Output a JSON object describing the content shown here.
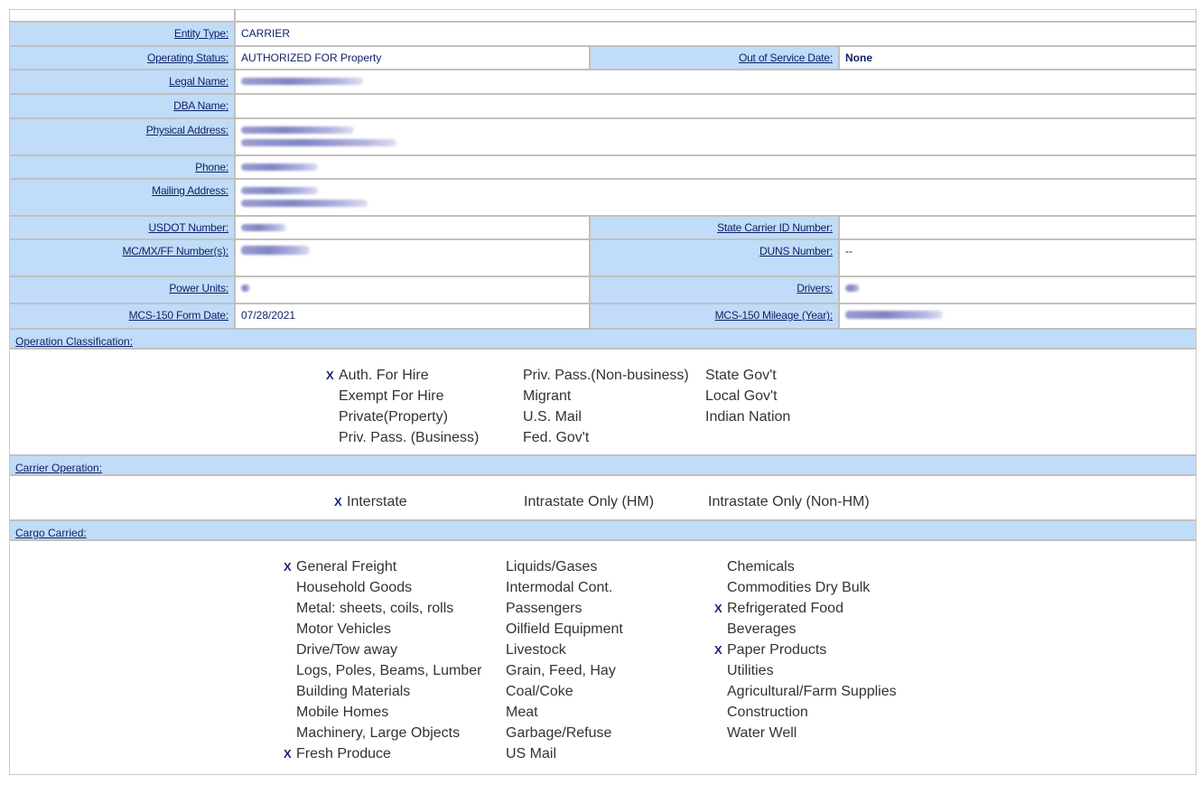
{
  "fields": {
    "entity_type": {
      "label": "Entity Type:",
      "value": "CARRIER"
    },
    "operating_status": {
      "label": "Operating Status:",
      "value": "AUTHORIZED FOR Property"
    },
    "out_of_service_date": {
      "label": "Out of Service Date:",
      "value": "None"
    },
    "legal_name": {
      "label": "Legal Name:",
      "value": "[redacted]"
    },
    "dba_name": {
      "label": "DBA Name:",
      "value": ""
    },
    "physical_address": {
      "label": "Physical Address:",
      "value": "[redacted]"
    },
    "phone": {
      "label": "Phone:",
      "value": "[redacted]"
    },
    "mailing_address": {
      "label": "Mailing Address:",
      "value": "[redacted]"
    },
    "usdot_number": {
      "label": "USDOT Number:",
      "value": "[redacted]"
    },
    "state_carrier_id": {
      "label": "State Carrier ID Number:",
      "value": ""
    },
    "mc_mx_ff": {
      "label": "MC/MX/FF Number(s):",
      "value": "[redacted]"
    },
    "duns_number": {
      "label": "DUNS Number:",
      "value": "--"
    },
    "power_units": {
      "label": "Power Units:",
      "value": "[redacted]"
    },
    "drivers": {
      "label": "Drivers:",
      "value": "[redacted]"
    },
    "mcs150_form_date": {
      "label": "MCS-150 Form Date:",
      "value": "07/28/2021"
    },
    "mcs150_mileage": {
      "label": "MCS-150 Mileage (Year):",
      "value": "[redacted]"
    }
  },
  "operation_classification": {
    "title": "Operation Classification:",
    "columns": [
      [
        {
          "label": "Auth. For Hire",
          "checked": true
        },
        {
          "label": "Exempt For Hire",
          "checked": false
        },
        {
          "label": "Private(Property)",
          "checked": false
        },
        {
          "label": "Priv. Pass. (Business)",
          "checked": false
        }
      ],
      [
        {
          "label": "Priv. Pass.(Non-business)",
          "checked": false
        },
        {
          "label": "Migrant",
          "checked": false
        },
        {
          "label": "U.S. Mail",
          "checked": false
        },
        {
          "label": "Fed. Gov't",
          "checked": false
        }
      ],
      [
        {
          "label": "State Gov't",
          "checked": false
        },
        {
          "label": "Local Gov't",
          "checked": false
        },
        {
          "label": "Indian Nation",
          "checked": false
        }
      ]
    ]
  },
  "carrier_operation": {
    "title": "Carrier Operation:",
    "columns": [
      [
        {
          "label": "Interstate",
          "checked": true
        }
      ],
      [
        {
          "label": "Intrastate Only (HM)",
          "checked": false
        }
      ],
      [
        {
          "label": "Intrastate Only (Non-HM)",
          "checked": false
        }
      ]
    ]
  },
  "cargo_carried": {
    "title": "Cargo Carried:",
    "columns": [
      [
        {
          "label": "General Freight",
          "checked": true
        },
        {
          "label": "Household Goods",
          "checked": false
        },
        {
          "label": "Metal: sheets, coils, rolls",
          "checked": false
        },
        {
          "label": "Motor Vehicles",
          "checked": false
        },
        {
          "label": "Drive/Tow away",
          "checked": false
        },
        {
          "label": "Logs, Poles, Beams, Lumber",
          "checked": false
        },
        {
          "label": "Building Materials",
          "checked": false
        },
        {
          "label": "Mobile Homes",
          "checked": false
        },
        {
          "label": "Machinery, Large Objects",
          "checked": false
        },
        {
          "label": "Fresh Produce",
          "checked": true
        }
      ],
      [
        {
          "label": "Liquids/Gases",
          "checked": false
        },
        {
          "label": "Intermodal Cont.",
          "checked": false
        },
        {
          "label": "Passengers",
          "checked": false
        },
        {
          "label": "Oilfield Equipment",
          "checked": false
        },
        {
          "label": "Livestock",
          "checked": false
        },
        {
          "label": "Grain, Feed, Hay",
          "checked": false
        },
        {
          "label": "Coal/Coke",
          "checked": false
        },
        {
          "label": "Meat",
          "checked": false
        },
        {
          "label": "Garbage/Refuse",
          "checked": false
        },
        {
          "label": "US Mail",
          "checked": false
        }
      ],
      [
        {
          "label": "Chemicals",
          "checked": false
        },
        {
          "label": "Commodities Dry Bulk",
          "checked": false
        },
        {
          "label": "Refrigerated Food",
          "checked": true
        },
        {
          "label": "Beverages",
          "checked": false
        },
        {
          "label": "Paper Products",
          "checked": true
        },
        {
          "label": "Utilities",
          "checked": false
        },
        {
          "label": "Agricultural/Farm Supplies",
          "checked": false
        },
        {
          "label": "Construction",
          "checked": false
        },
        {
          "label": "Water Well",
          "checked": false
        }
      ]
    ]
  },
  "check_mark": "X",
  "colors": {
    "label_bg": "#c0dcf8",
    "link": "#0f1f64",
    "border": "#c0c0c0",
    "mark": "#1a237e"
  }
}
